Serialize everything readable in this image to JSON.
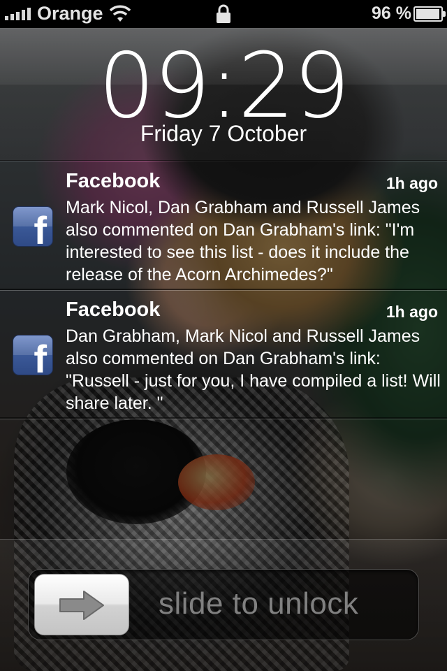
{
  "status_bar": {
    "carrier": "Orange",
    "battery_percent": "96 %",
    "signal_bars": 5,
    "icons": [
      "signal-icon",
      "wifi-icon",
      "lock-icon",
      "battery-icon"
    ]
  },
  "clock": {
    "time": "09:29",
    "date": "Friday 7 October"
  },
  "notifications": [
    {
      "app": "Facebook",
      "time": "1h ago",
      "message": "Mark Nicol, Dan Grabham and Russell James also commented on Dan Grabham's link: \"I'm interested to see this list - does it include the release of the Acorn Archimedes?\"",
      "icon": "facebook-icon"
    },
    {
      "app": "Facebook",
      "time": "1h ago",
      "message": "Dan Grabham, Mark Nicol and Russell James also commented on Dan Grabham's link: \"Russell - just for you,  I have compiled a list! Will share later. \"",
      "icon": "facebook-icon"
    }
  ],
  "unlock": {
    "label": "slide to unlock",
    "icon": "arrow-right-icon"
  }
}
